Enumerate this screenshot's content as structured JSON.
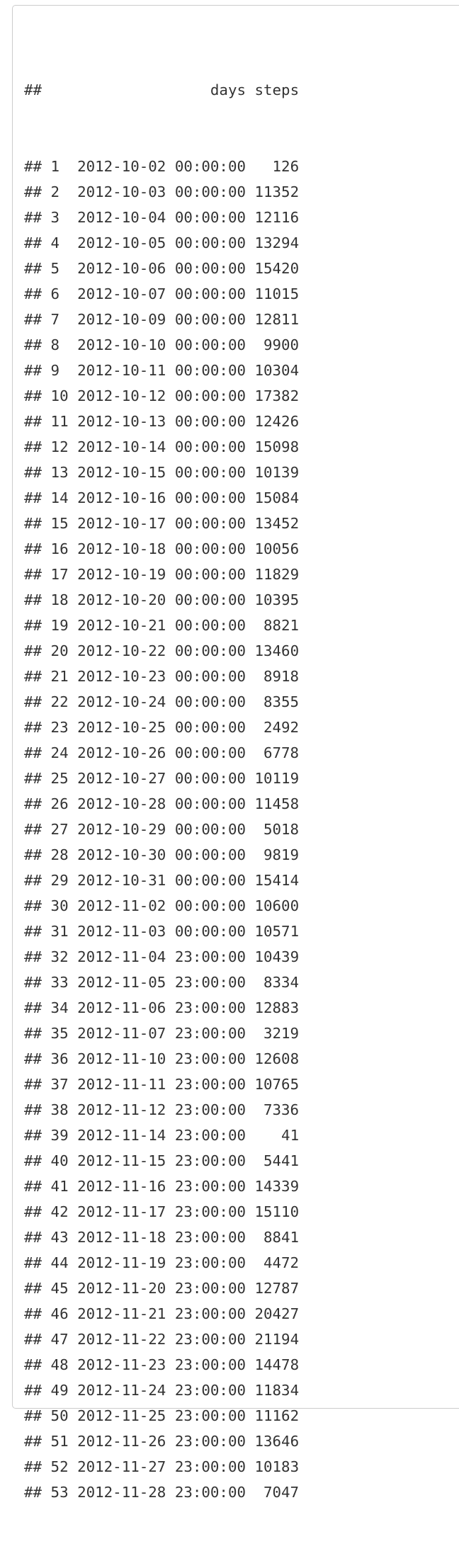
{
  "prefix": "##",
  "header": {
    "days": "days",
    "steps": "steps"
  },
  "rows": [
    {
      "i": "1",
      "day": "2012-10-02 00:00:00",
      "steps": "126"
    },
    {
      "i": "2",
      "day": "2012-10-03 00:00:00",
      "steps": "11352"
    },
    {
      "i": "3",
      "day": "2012-10-04 00:00:00",
      "steps": "12116"
    },
    {
      "i": "4",
      "day": "2012-10-05 00:00:00",
      "steps": "13294"
    },
    {
      "i": "5",
      "day": "2012-10-06 00:00:00",
      "steps": "15420"
    },
    {
      "i": "6",
      "day": "2012-10-07 00:00:00",
      "steps": "11015"
    },
    {
      "i": "7",
      "day": "2012-10-09 00:00:00",
      "steps": "12811"
    },
    {
      "i": "8",
      "day": "2012-10-10 00:00:00",
      "steps": "9900"
    },
    {
      "i": "9",
      "day": "2012-10-11 00:00:00",
      "steps": "10304"
    },
    {
      "i": "10",
      "day": "2012-10-12 00:00:00",
      "steps": "17382"
    },
    {
      "i": "11",
      "day": "2012-10-13 00:00:00",
      "steps": "12426"
    },
    {
      "i": "12",
      "day": "2012-10-14 00:00:00",
      "steps": "15098"
    },
    {
      "i": "13",
      "day": "2012-10-15 00:00:00",
      "steps": "10139"
    },
    {
      "i": "14",
      "day": "2012-10-16 00:00:00",
      "steps": "15084"
    },
    {
      "i": "15",
      "day": "2012-10-17 00:00:00",
      "steps": "13452"
    },
    {
      "i": "16",
      "day": "2012-10-18 00:00:00",
      "steps": "10056"
    },
    {
      "i": "17",
      "day": "2012-10-19 00:00:00",
      "steps": "11829"
    },
    {
      "i": "18",
      "day": "2012-10-20 00:00:00",
      "steps": "10395"
    },
    {
      "i": "19",
      "day": "2012-10-21 00:00:00",
      "steps": "8821"
    },
    {
      "i": "20",
      "day": "2012-10-22 00:00:00",
      "steps": "13460"
    },
    {
      "i": "21",
      "day": "2012-10-23 00:00:00",
      "steps": "8918"
    },
    {
      "i": "22",
      "day": "2012-10-24 00:00:00",
      "steps": "8355"
    },
    {
      "i": "23",
      "day": "2012-10-25 00:00:00",
      "steps": "2492"
    },
    {
      "i": "24",
      "day": "2012-10-26 00:00:00",
      "steps": "6778"
    },
    {
      "i": "25",
      "day": "2012-10-27 00:00:00",
      "steps": "10119"
    },
    {
      "i": "26",
      "day": "2012-10-28 00:00:00",
      "steps": "11458"
    },
    {
      "i": "27",
      "day": "2012-10-29 00:00:00",
      "steps": "5018"
    },
    {
      "i": "28",
      "day": "2012-10-30 00:00:00",
      "steps": "9819"
    },
    {
      "i": "29",
      "day": "2012-10-31 00:00:00",
      "steps": "15414"
    },
    {
      "i": "30",
      "day": "2012-11-02 00:00:00",
      "steps": "10600"
    },
    {
      "i": "31",
      "day": "2012-11-03 00:00:00",
      "steps": "10571"
    },
    {
      "i": "32",
      "day": "2012-11-04 23:00:00",
      "steps": "10439"
    },
    {
      "i": "33",
      "day": "2012-11-05 23:00:00",
      "steps": "8334"
    },
    {
      "i": "34",
      "day": "2012-11-06 23:00:00",
      "steps": "12883"
    },
    {
      "i": "35",
      "day": "2012-11-07 23:00:00",
      "steps": "3219"
    },
    {
      "i": "36",
      "day": "2012-11-10 23:00:00",
      "steps": "12608"
    },
    {
      "i": "37",
      "day": "2012-11-11 23:00:00",
      "steps": "10765"
    },
    {
      "i": "38",
      "day": "2012-11-12 23:00:00",
      "steps": "7336"
    },
    {
      "i": "39",
      "day": "2012-11-14 23:00:00",
      "steps": "41"
    },
    {
      "i": "40",
      "day": "2012-11-15 23:00:00",
      "steps": "5441"
    },
    {
      "i": "41",
      "day": "2012-11-16 23:00:00",
      "steps": "14339"
    },
    {
      "i": "42",
      "day": "2012-11-17 23:00:00",
      "steps": "15110"
    },
    {
      "i": "43",
      "day": "2012-11-18 23:00:00",
      "steps": "8841"
    },
    {
      "i": "44",
      "day": "2012-11-19 23:00:00",
      "steps": "4472"
    },
    {
      "i": "45",
      "day": "2012-11-20 23:00:00",
      "steps": "12787"
    },
    {
      "i": "46",
      "day": "2012-11-21 23:00:00",
      "steps": "20427"
    },
    {
      "i": "47",
      "day": "2012-11-22 23:00:00",
      "steps": "21194"
    },
    {
      "i": "48",
      "day": "2012-11-23 23:00:00",
      "steps": "14478"
    },
    {
      "i": "49",
      "day": "2012-11-24 23:00:00",
      "steps": "11834"
    },
    {
      "i": "50",
      "day": "2012-11-25 23:00:00",
      "steps": "11162"
    },
    {
      "i": "51",
      "day": "2012-11-26 23:00:00",
      "steps": "13646"
    },
    {
      "i": "52",
      "day": "2012-11-27 23:00:00",
      "steps": "10183"
    },
    {
      "i": "53",
      "day": "2012-11-28 23:00:00",
      "steps": "7047"
    }
  ]
}
